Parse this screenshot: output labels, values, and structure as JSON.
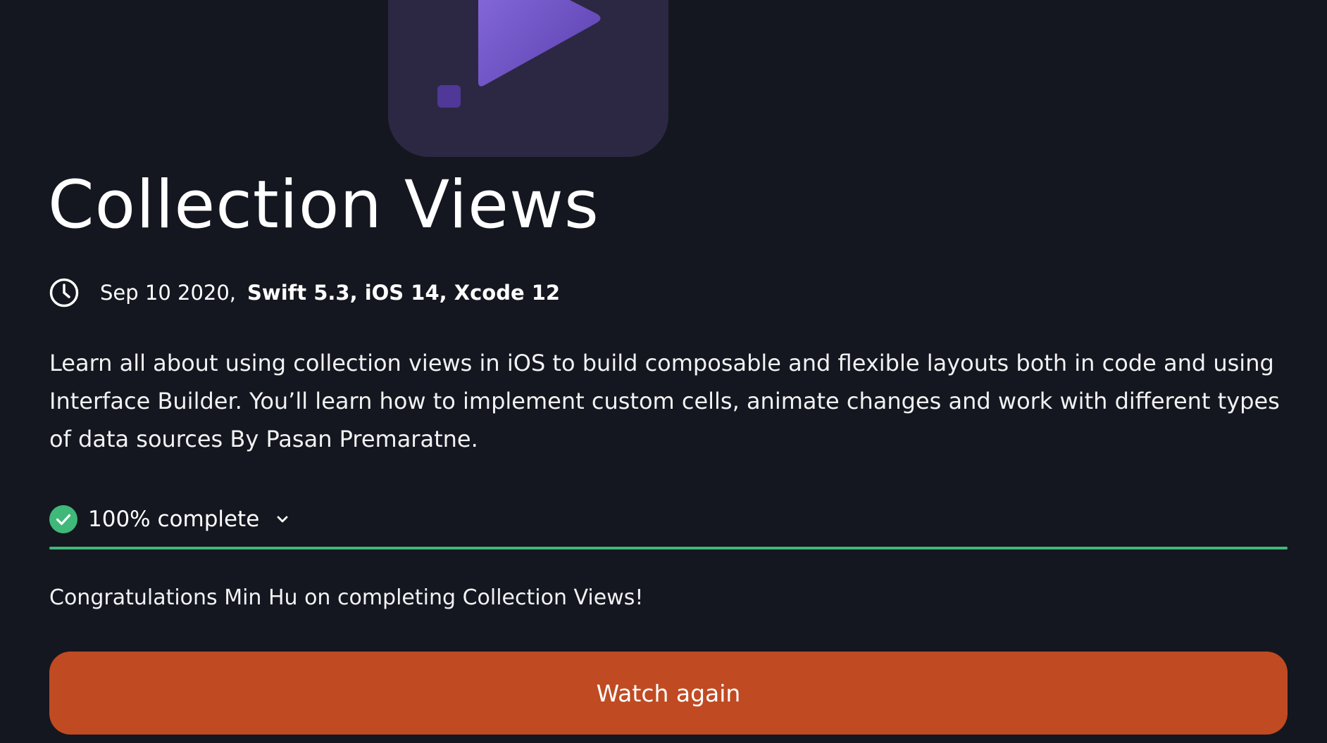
{
  "course": {
    "title": "Collection Views",
    "date": "Sep 10 2020,",
    "versions": "Swift 5.3, iOS 14, Xcode 12",
    "description": "Learn all about using collection views in iOS to build composable and flexible layouts both in code and using Interface Builder. You’ll learn how to implement custom cells, animate changes and work with different types of data sources By Pasan Premaratne.",
    "artwork_icon": "play-triangle-icon"
  },
  "progress": {
    "label": "100% complete",
    "percent": 100,
    "status_icon": "check-circle-icon",
    "toggle_icon": "chevron-down-icon",
    "color": "#3fb87a"
  },
  "completion": {
    "message": "Congratulations Min Hu on completing Collection Views!"
  },
  "actions": {
    "watch_again_label": "Watch again",
    "button_color": "#c04a22"
  },
  "theme": {
    "background": "#14171f",
    "artwork_background": "#2c2843",
    "accent_purple": "#7b5bd6"
  }
}
